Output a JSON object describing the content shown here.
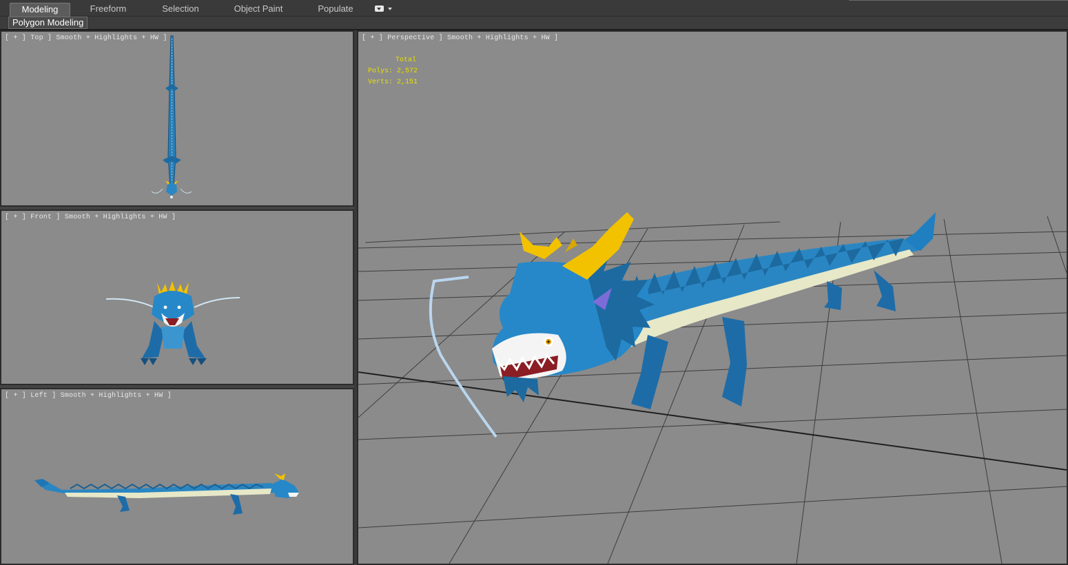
{
  "ribbon": {
    "tabs": [
      {
        "label": "Modeling",
        "active": true
      },
      {
        "label": "Freeform",
        "active": false
      },
      {
        "label": "Selection",
        "active": false
      },
      {
        "label": "Object Paint",
        "active": false
      },
      {
        "label": "Populate",
        "active": false
      }
    ],
    "options_icon": "dropdown-options-icon"
  },
  "subribbon": {
    "panel_label": "Polygon Modeling"
  },
  "viewports": {
    "top": {
      "label": "[ + ] Top ] Smooth + Highlights + HW ]"
    },
    "front": {
      "label": "[ + ] Front ] Smooth + Highlights + HW ]"
    },
    "left": {
      "label": "[ + ] Left ] Smooth + Highlights + HW ]"
    },
    "perspective": {
      "label": "[ + ] Perspective ] Smooth + Highlights + HW ]",
      "stats": {
        "header": "Total",
        "polys_label": "Polys:",
        "polys": "2,572",
        "verts_label": "Verts:",
        "verts": "2,151"
      }
    }
  },
  "colors": {
    "viewport_bg": "#8b8b8b",
    "stats_text": "#e8e000",
    "dragon_blue": "#1f7fc0",
    "dragon_belly": "#e6e8c8",
    "dragon_horn": "#f2c200"
  }
}
